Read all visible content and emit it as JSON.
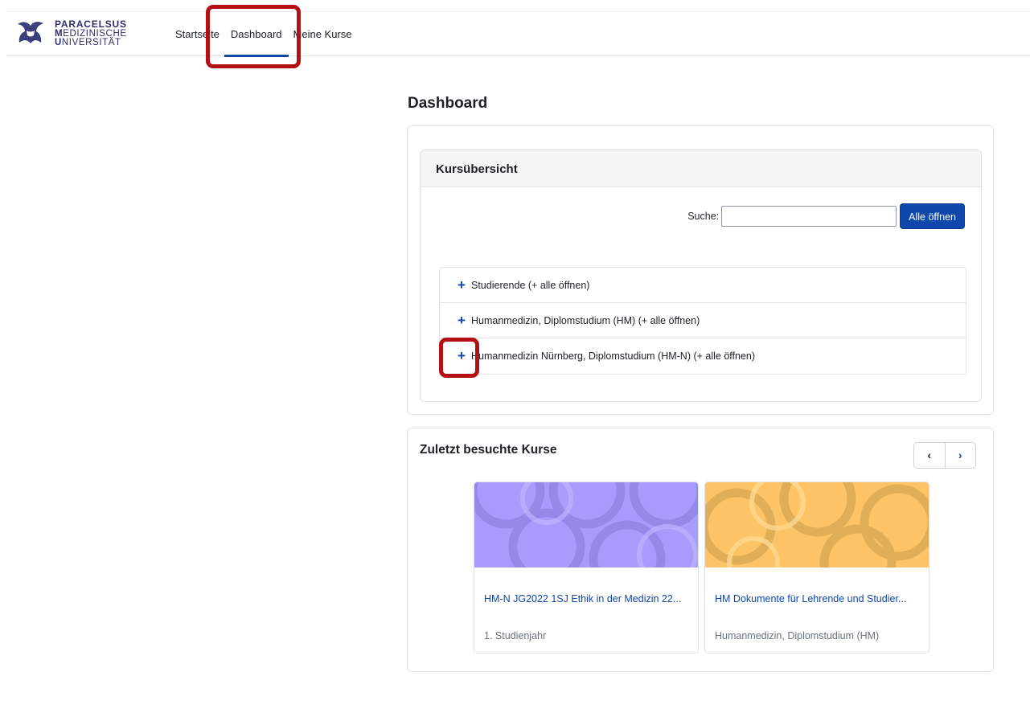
{
  "brand": {
    "line1": "PARACELSUS",
    "line2_cap": "M",
    "line2_rest": "EDIZINISCHE",
    "line3_cap": "U",
    "line3_rest": "NIVERSITÄT"
  },
  "nav": {
    "items": [
      {
        "label": "Startseite"
      },
      {
        "label": "Dashboard",
        "active": true
      },
      {
        "label": "Meine Kurse"
      }
    ]
  },
  "page": {
    "title": "Dashboard"
  },
  "overview": {
    "title": "Kursübersicht",
    "search_label": "Suche:",
    "search_value": "",
    "open_all_button": "Alle öffnen",
    "categories": [
      {
        "label": "Studierende (+ alle öffnen)"
      },
      {
        "label": "Humanmedizin, Diplomstudium (HM) (+ alle öffnen)"
      },
      {
        "label": "Humanmedizin Nürnberg, Diplomstudium (HM-N) (+ alle öffnen)"
      }
    ]
  },
  "recent": {
    "title": "Zuletzt besuchte Kurse",
    "prev_icon": "chevron-left-icon",
    "next_icon": "chevron-right-icon",
    "courses": [
      {
        "name": "HM-N JG2022 1SJ Ethik in der Medizin 22...",
        "category": "1. Studienjahr",
        "color": "#a79bfb"
      },
      {
        "name": "HM Dokumente für Lehrende und Studier...",
        "category": "Humanmedizin, Diplomstudium (HM)",
        "color": "#fcc466"
      }
    ]
  },
  "colors": {
    "accent": "#0f47ad",
    "highlight": "#b40f13"
  }
}
